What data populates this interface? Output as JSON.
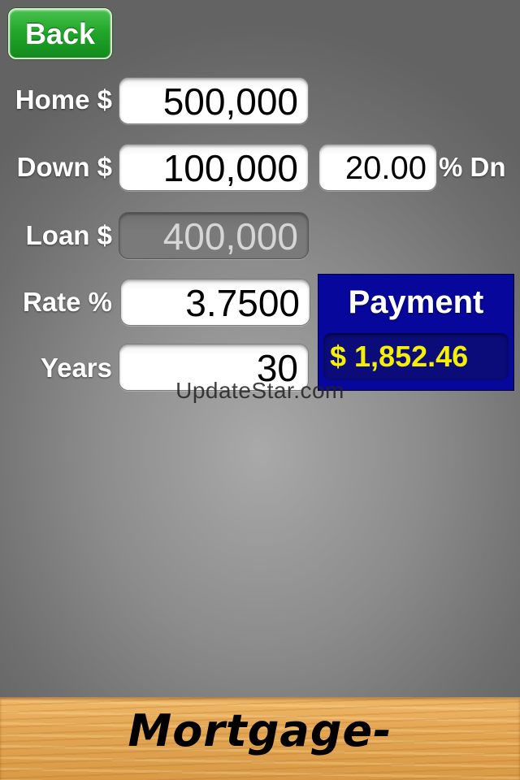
{
  "nav": {
    "back_label": "Back"
  },
  "form": {
    "home": {
      "label": "Home $",
      "value": "500,000"
    },
    "down": {
      "label": "Down $",
      "value": "100,000",
      "percent_value": "20.00",
      "percent_label": "% Dn"
    },
    "loan": {
      "label": "Loan $",
      "value": "400,000"
    },
    "rate": {
      "label": "Rate %",
      "value": "3.7500"
    },
    "years": {
      "label": "Years",
      "value": "30"
    }
  },
  "payment": {
    "title": "Payment",
    "value": "$ 1,852.46"
  },
  "watermark": "UpdateStar.com",
  "footer": {
    "title": "Mortgage-"
  },
  "colors": {
    "back_button": "#22a72a",
    "payment_panel": "#07079c",
    "payment_value": "#f4f000",
    "wood": "#e3a653"
  }
}
